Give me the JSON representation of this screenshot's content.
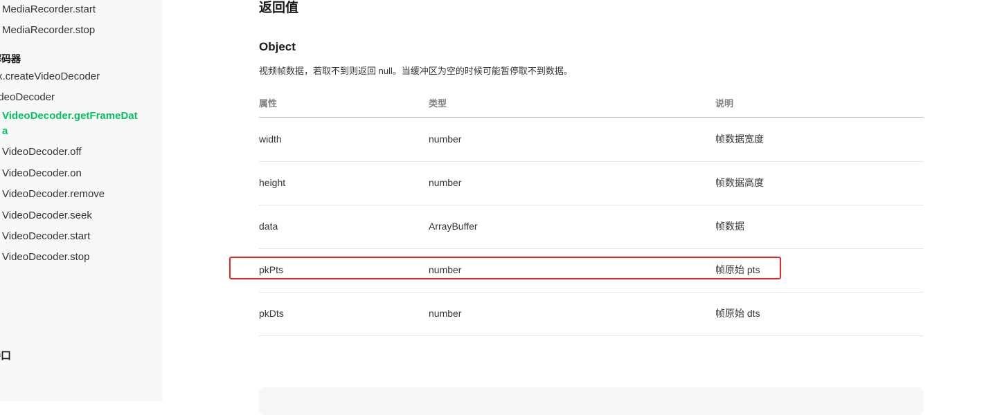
{
  "sidebar": {
    "items": [
      {
        "label": "MediaRecorder.start"
      },
      {
        "label": "MediaRecorder.stop"
      }
    ],
    "group_video_decoder": "解码器",
    "video_decoder_items": [
      {
        "label": "x.createVideoDecoder"
      },
      {
        "label": "ideoDecoder"
      }
    ],
    "active_item": "VideoDecoder.getFrameData",
    "sub_items": [
      {
        "label": "VideoDecoder.off"
      },
      {
        "label": "VideoDecoder.on"
      },
      {
        "label": "VideoDecoder.remove"
      },
      {
        "label": "VideoDecoder.seek"
      },
      {
        "label": "VideoDecoder.start"
      },
      {
        "label": "VideoDecoder.stop"
      }
    ],
    "group_interface": "接口"
  },
  "content": {
    "return_title": "返回值",
    "object_title": "Object",
    "description": "视频帧数据，若取不到则返回 null。当缓冲区为空的时候可能暂停取不到数据。",
    "table": {
      "headers": [
        "属性",
        "类型",
        "说明"
      ],
      "rows": [
        {
          "name": "width",
          "type": "number",
          "desc": "帧数据宽度"
        },
        {
          "name": "height",
          "type": "number",
          "desc": "帧数据高度"
        },
        {
          "name": "data",
          "type": "ArrayBuffer",
          "desc": "帧数据"
        },
        {
          "name": "pkPts",
          "type": "number",
          "desc": "帧原始 pts"
        },
        {
          "name": "pkDts",
          "type": "number",
          "desc": "帧原始 dts"
        }
      ]
    }
  },
  "colors": {
    "accent": "#07c160",
    "highlight": "#e8272a"
  }
}
